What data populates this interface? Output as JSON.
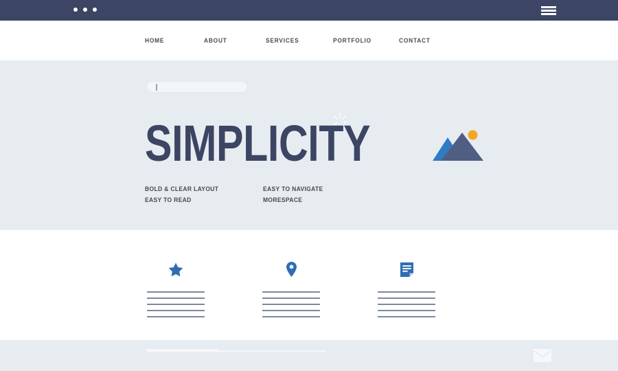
{
  "window": {
    "dots_count": 3,
    "dot_color": "#ffffff",
    "bar_color": "#3c4563",
    "menu_icon": "hamburger-icon"
  },
  "nav": {
    "items": [
      {
        "label": "HOME"
      },
      {
        "label": "ABOUT"
      },
      {
        "label": "SERVICES"
      },
      {
        "label": "PORTFOLIO"
      },
      {
        "label": "CONTACT"
      }
    ]
  },
  "hero": {
    "background_color": "#e7ecf1",
    "search": {
      "value": "",
      "placeholder": ""
    },
    "headline": "SIMPLICITY",
    "headline_color": "#3c4563",
    "decoration": "sparkle-icon",
    "taglines": [
      {
        "line1": "BOLD & CLEAR LAYOUT",
        "line2": "EASY TO READ"
      },
      {
        "line1": "EASY TO NAVIGATE",
        "line2": "MORESPACE"
      }
    ],
    "image": {
      "name": "mountain-image-placeholder",
      "peak_front_color": "#515e83",
      "peak_back_color": "#2e7cc4",
      "sun_color": "#f5a623"
    }
  },
  "features": {
    "line_color": "#7d899c",
    "icon_color": "#2e6db4",
    "items": [
      {
        "icon": "star-icon",
        "lines": 5
      },
      {
        "icon": "location-pin-icon",
        "lines": 5
      },
      {
        "icon": "document-icon",
        "lines": 5
      }
    ]
  },
  "footer": {
    "background_color": "#e7ecf1",
    "line_color": "#f6f8fa",
    "lines": 2,
    "icon": "envelope-icon"
  }
}
